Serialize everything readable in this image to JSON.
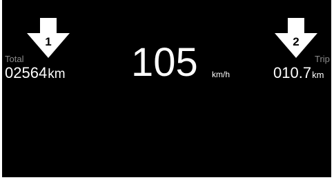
{
  "indicators": [
    {
      "number": "1"
    },
    {
      "number": "2"
    }
  ],
  "total": {
    "label": "Total",
    "value": "02564",
    "unit": "km"
  },
  "speed": {
    "value": "105",
    "unit": "km/h"
  },
  "trip": {
    "label": "Trip",
    "value": "010.7",
    "unit": "km"
  },
  "colors": {
    "background": "#000000",
    "text": "#ffffff",
    "label": "#8c8c8c",
    "frame": "#ffffff"
  }
}
